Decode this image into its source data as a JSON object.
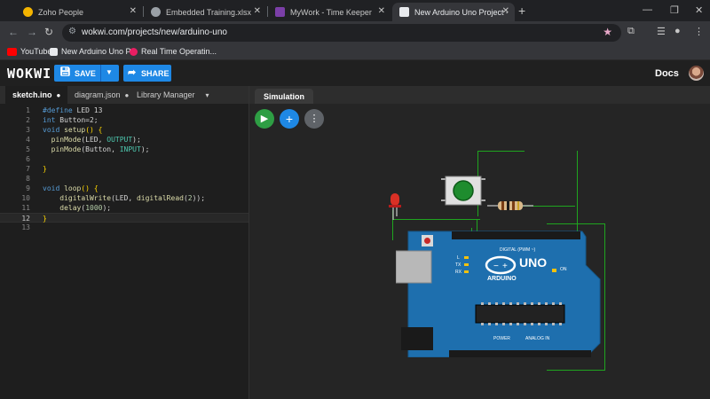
{
  "browser": {
    "tabs": [
      {
        "title": "Zoho People",
        "active": false
      },
      {
        "title": "Embedded Training.xlsx",
        "active": false
      },
      {
        "title": "MyWork - Time Keeper",
        "active": false
      },
      {
        "title": "New Arduino Uno Project - Wo",
        "active": true
      }
    ],
    "url": "wokwi.com/projects/new/arduino-uno",
    "bookmarks": [
      {
        "label": "YouTube"
      },
      {
        "label": "New Arduino Uno P..."
      },
      {
        "label": "Real Time Operatin..."
      }
    ]
  },
  "app": {
    "logo": "WOKWI",
    "save_label": "SAVE",
    "share_label": "SHARE",
    "docs_label": "Docs"
  },
  "editor": {
    "tabs": [
      {
        "label": "sketch.ino",
        "modified": "●"
      },
      {
        "label": "diagram.json",
        "modified": "●"
      },
      {
        "label": "Library Manager",
        "modified": "▾"
      }
    ],
    "line_numbers": [
      "1",
      "2",
      "3",
      "4",
      "5",
      "6",
      "7",
      "8",
      "9",
      "10",
      "11",
      "12",
      "13"
    ],
    "current_line": 12
  },
  "simulation": {
    "tab_label": "Simulation",
    "board_label": "UNO",
    "brand_label": "ARDUINO",
    "digital_label": "DIGITAL (PWM ~)",
    "power_label": "POWER",
    "analog_label": "ANALOG IN",
    "on_label": "ON",
    "tx_label": "TX",
    "rx_label": "RX",
    "l_label": "L"
  },
  "colors": {
    "accent": "#1e88e5",
    "run_button": "#2e9e44",
    "add_button": "#1e88e5",
    "wire": "#1fa51f",
    "board": "#1e6fae",
    "led": "#d93025",
    "button_cap": "#1e8c2e"
  },
  "icons": {
    "run": "play-icon",
    "add": "plus-icon",
    "more": "more-vert-icon"
  }
}
